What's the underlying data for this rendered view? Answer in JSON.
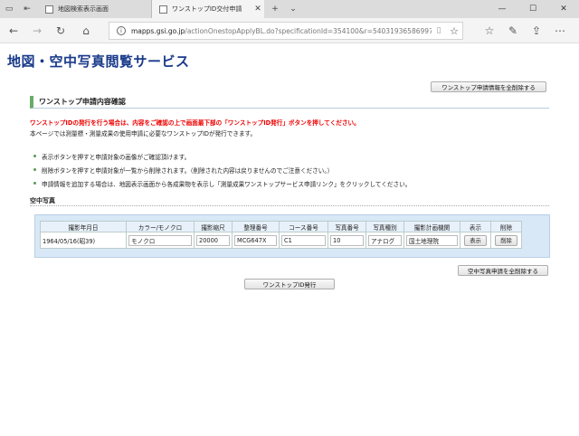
{
  "browser": {
    "tabs": [
      {
        "title": "地図検索表示画面"
      },
      {
        "title": "ワンストップID交付申請"
      }
    ],
    "address": {
      "host": "mapps.gsi.go.jp",
      "path": "/actionOnestopApplyBL.do?specificationId=354100&r=540319365869971"
    }
  },
  "page": {
    "site_title": "地図・空中写真閲覧サービス",
    "delete_all_apply_label": "ワンストップ申請情報を全削除する",
    "section_title": "ワンストップ申請内容確認",
    "warning": "ワンストップIDの発行を行う場合は、内容をご確認の上で画面最下部の「ワンストップID発行」ボタンを押してください。",
    "description": "本ページでは測量標・測量成果の使用申請に必要なワンストップIDが発行できます。",
    "bullets": [
      "表示ボタンを押すと申請対象の画像がご確認頂けます。",
      "削除ボタンを押すと申請対象が一覧から削除されます。（削除された内容は戻りませんのでご注意ください。）",
      "申請情報を追加する場合は、地図表示画面から各成果物を表示し「測量成果ワンストップサービス申請リンク」をクリックしてください。"
    ],
    "subhead": "空中写真",
    "table": {
      "headers": [
        "撮影年月日",
        "カラー/モノクロ",
        "撮影縮尺",
        "整理番号",
        "コース番号",
        "写真番号",
        "写真種別",
        "撮影計画機関",
        "表示",
        "削除"
      ],
      "rows": [
        {
          "date": "1964/05/16(昭39)",
          "color": "モノクロ",
          "scale": "20000",
          "seiri": "MCG647X",
          "course": "C1",
          "photo_no": "10",
          "kind": "アナログ",
          "org": "国土地理院",
          "show": "表示",
          "delete": "削除"
        }
      ]
    },
    "delete_all_photo_label": "空中写真申請を全削除する",
    "issue_label": "ワンストップID発行"
  }
}
